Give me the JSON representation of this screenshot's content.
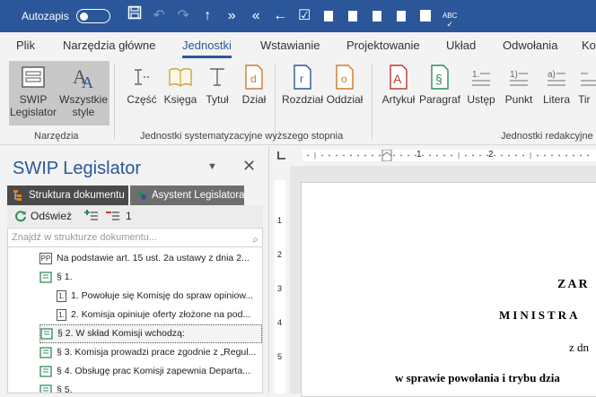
{
  "titlebar": {
    "autosave_label": "Autozapis",
    "quick_access": [
      "save-icon",
      "undo-icon",
      "redo-icon",
      "arrow-up-icon",
      "double-right-icon",
      "double-left-icon",
      "arrow-left-icon",
      "checkbox-icon",
      "square-icon",
      "square-icon",
      "square-icon",
      "square-icon",
      "font-a-icon",
      "abc-icon"
    ],
    "abc_label": "ABC"
  },
  "tabs": [
    "Plik",
    "Narzędzia główne",
    "Jednostki",
    "Wstawianie",
    "Projektowanie",
    "Układ",
    "Odwołania",
    "Ko"
  ],
  "active_tab": "Jednostki",
  "ribbon": {
    "swip": [
      "SWIP",
      "Legislator"
    ],
    "styles": [
      "Wszystkie",
      "style"
    ],
    "narzedzia_group": "Narzędzia",
    "systematyzacyjne": [
      "Część",
      "Księga",
      "Tytuł",
      "Dział"
    ],
    "rozdzial": "Rozdział",
    "oddzial": "Oddział",
    "systematyzacyjne_group": "Jednostki systematyzacyjne wyższego stopnia",
    "redakcyjne": [
      "Artykuł",
      "Paragraf",
      "Ustęp",
      "Punkt",
      "Litera",
      "Tir"
    ],
    "redakcyjne_group": "Jednostki redakcyjne",
    "icon_letters": {
      "dzial": "d",
      "rozdzial": "r",
      "oddzial": "o",
      "artykul": "A",
      "paragraf": "§",
      "ustep": "1.",
      "punkt": "1)",
      "litera": "a)"
    }
  },
  "pane": {
    "title": "SWIP Legislator",
    "tab_struktura": "Struktura dokumentu",
    "tab_asystent": "Asystent Legislatora",
    "refresh_label": "Odśwież",
    "count": "1",
    "search_placeholder": "Znajdź w strukturze dokumentu...",
    "pp_label": "PP",
    "pkt_label": "1.",
    "nodes": [
      "Na podstawie art. 15 ust. 2a ustawy z dnia 2...",
      "§ 1.",
      "1. Powołuje się Komisję do spraw opiniow...",
      "2. Komisja opiniuje oferty złożone na pod...",
      "§ 2. W skład Komisji wchodzą:",
      "§ 3. Komisja prowadzi prace zgodnie z „Regul...",
      "§ 4. Obsługę prac Komisji zapewnia Departa...",
      "§ 5."
    ]
  },
  "ruler": {
    "h_marks": [
      "1",
      "2"
    ],
    "v_marks": [
      "1",
      "2",
      "3",
      "4",
      "5"
    ]
  },
  "document": {
    "lines": [
      "ZAR",
      "MINISTRA",
      "z dn",
      "w sprawie powołania i trybu dzia"
    ]
  },
  "colors": {
    "accent": "#2b579a",
    "green": "#2e8b57",
    "red": "#c0392b",
    "orange": "#d07a2a"
  }
}
